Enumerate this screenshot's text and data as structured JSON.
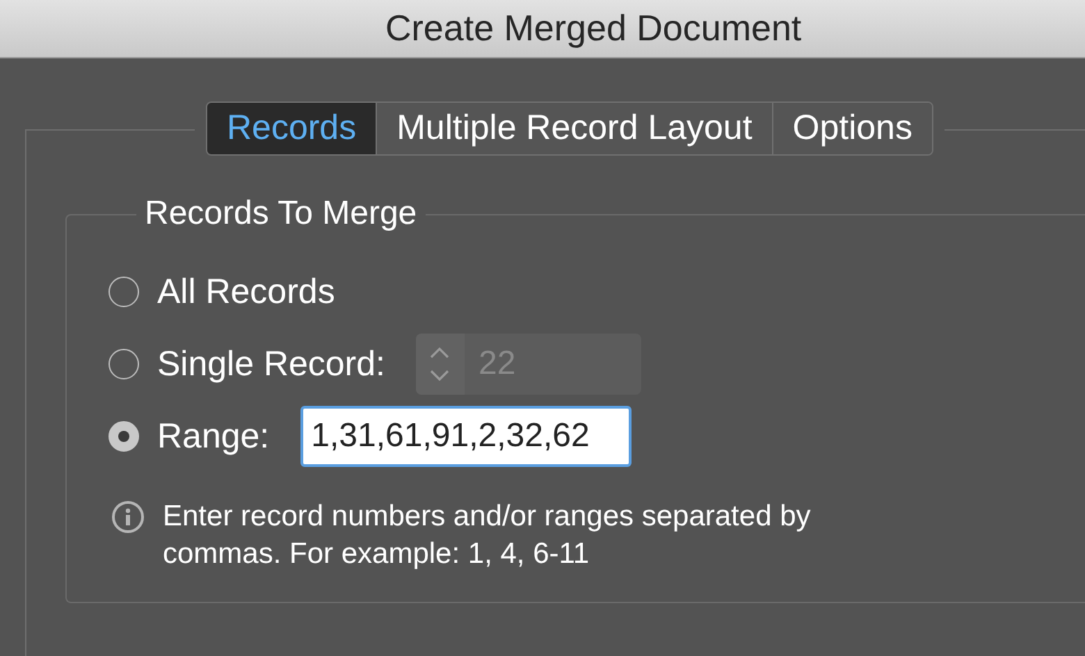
{
  "window": {
    "title": "Create Merged Document"
  },
  "tabs": [
    {
      "label": "Records",
      "selected": true
    },
    {
      "label": "Multiple Record Layout",
      "selected": false
    },
    {
      "label": "Options",
      "selected": false
    }
  ],
  "records_to_merge": {
    "title": "Records To Merge",
    "options": [
      {
        "kind": "plain",
        "label": "All Records",
        "selected": false
      },
      {
        "kind": "stepper",
        "label": "Single Record:",
        "selected": false,
        "value": "22",
        "disabled": true
      },
      {
        "kind": "text",
        "label": "Range:",
        "selected": true,
        "value": "1,31,61,91,2,32,62"
      }
    ],
    "info": "Enter record numbers and/or ranges separated by commas. For example: 1, 4, 6-11"
  }
}
